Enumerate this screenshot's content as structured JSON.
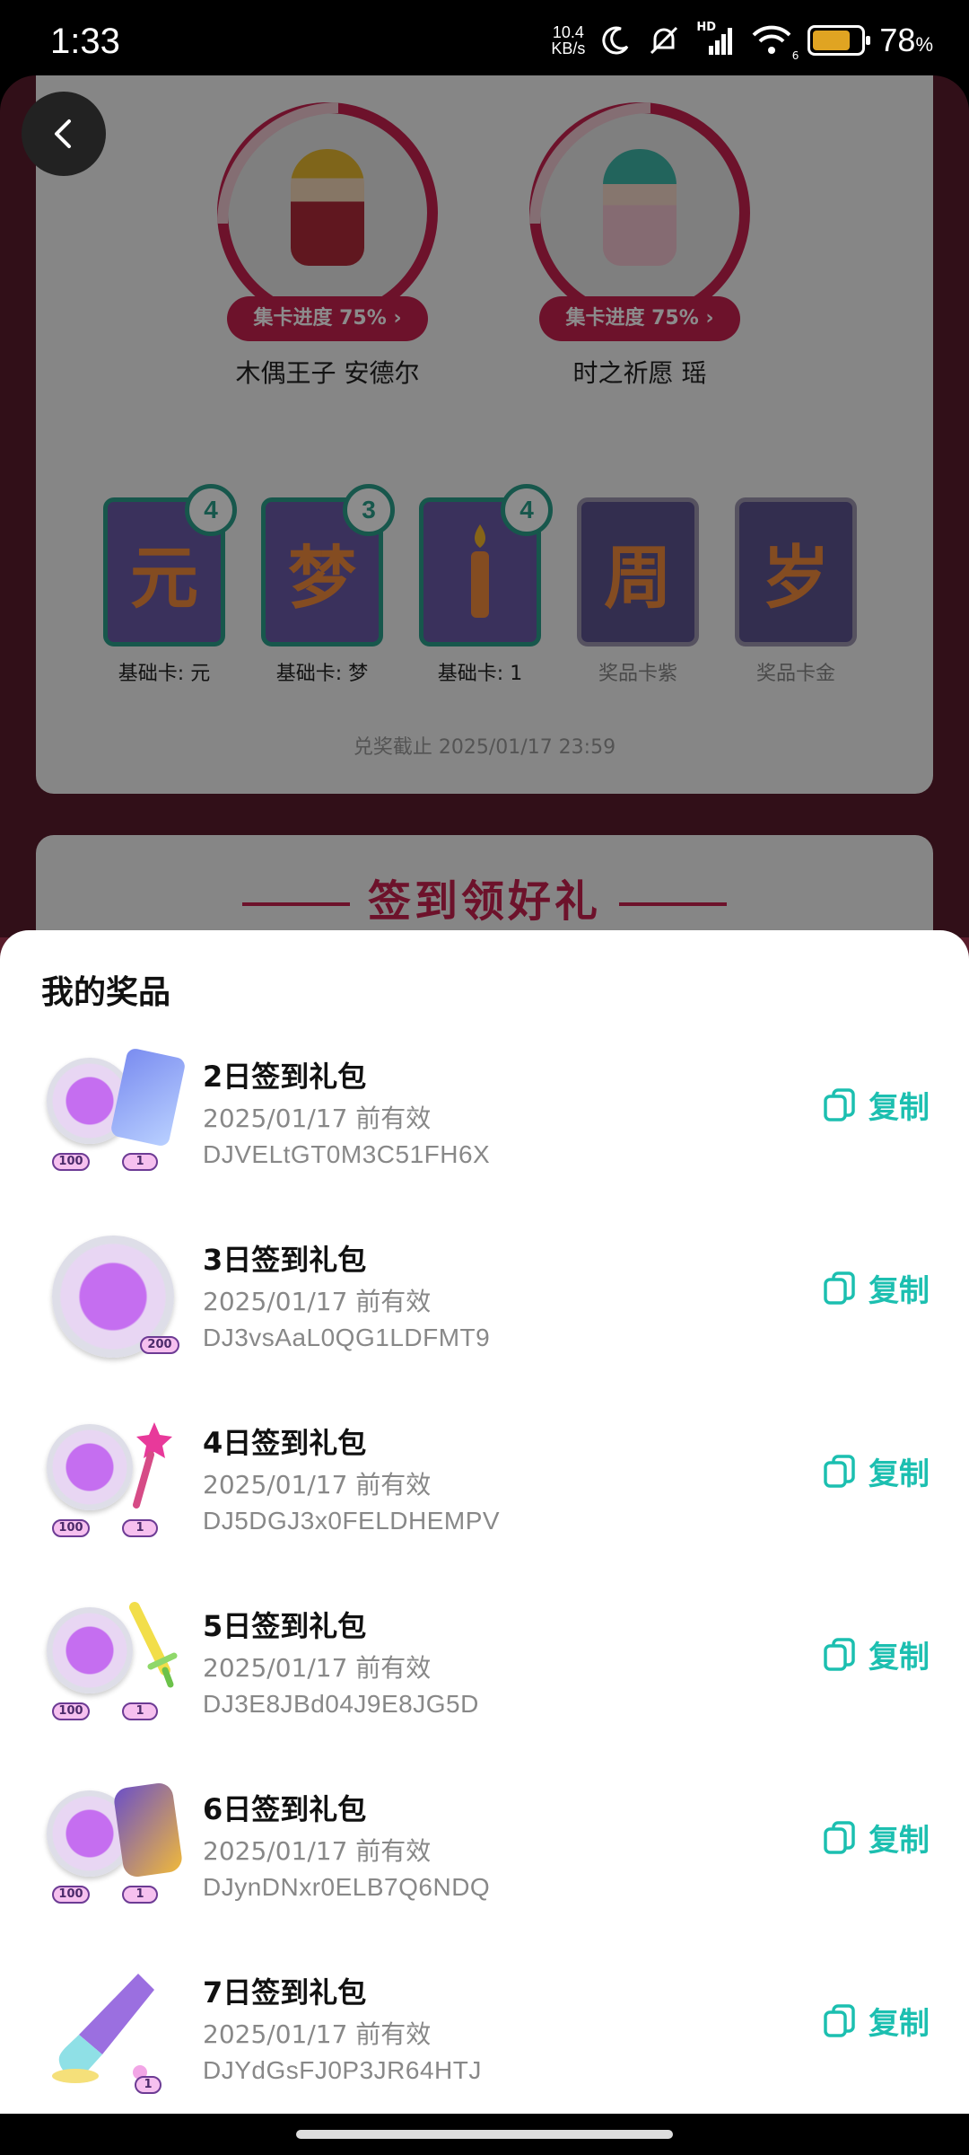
{
  "status_bar": {
    "time": "1:33",
    "net_speed_value": "10.4",
    "net_speed_unit": "KB/s",
    "hd_label": "HD",
    "wifi_sub": "6",
    "battery_level": 78,
    "battery_text": "78",
    "battery_unit": "%"
  },
  "characters": [
    {
      "name": "木偶王子 安德尔",
      "progress_label": "集卡进度 75%",
      "progress": 0.75,
      "chevron": "›"
    },
    {
      "name": "时之祈愿 瑶",
      "progress_label": "集卡进度 75%",
      "progress": 0.75,
      "chevron": "›"
    }
  ],
  "cards": [
    {
      "glyph": "元",
      "count": "4",
      "label": "基础卡: 元",
      "locked": false
    },
    {
      "glyph": "梦",
      "count": "3",
      "label": "基础卡: 梦",
      "locked": false
    },
    {
      "glyph": "",
      "count": "4",
      "label": "基础卡: 1",
      "locked": false
    },
    {
      "glyph": "周",
      "count": "",
      "label": "奖品卡紫",
      "locked": true
    },
    {
      "glyph": "岁",
      "count": "",
      "label": "奖品卡金",
      "locked": true
    }
  ],
  "deadline": "兑奖截止 2025/01/17 23:59",
  "signin_title": "签到领好礼",
  "sheet": {
    "title": "我的奖品",
    "copy_label": "复制",
    "prizes": [
      {
        "name": "2日签到礼包",
        "valid": "2025/01/17 前有效",
        "code": "DJVELtGT0M3C51FH6X",
        "tags": [
          "100",
          "1"
        ]
      },
      {
        "name": "3日签到礼包",
        "valid": "2025/01/17 前有效",
        "code": "DJ3vsAaL0QG1LDFMT9",
        "tags": [
          "200"
        ]
      },
      {
        "name": "4日签到礼包",
        "valid": "2025/01/17 前有效",
        "code": "DJ5DGJ3x0FELDHEMPV",
        "tags": [
          "100",
          "1"
        ]
      },
      {
        "name": "5日签到礼包",
        "valid": "2025/01/17 前有效",
        "code": "DJ3E8JBd04J9E8JG5D",
        "tags": [
          "100",
          "1"
        ]
      },
      {
        "name": "6日签到礼包",
        "valid": "2025/01/17 前有效",
        "code": "DJynDNxr0ELB7Q6NDQ",
        "tags": [
          "100",
          "1"
        ]
      },
      {
        "name": "7日签到礼包",
        "valid": "2025/01/17 前有效",
        "code": "DJYdGsFJ0P3JR64HTJ",
        "tags": [
          "1"
        ]
      }
    ]
  },
  "colors": {
    "accent": "#c7214f",
    "copy": "#1cbfb0",
    "card_border": "#2a9e8a"
  }
}
